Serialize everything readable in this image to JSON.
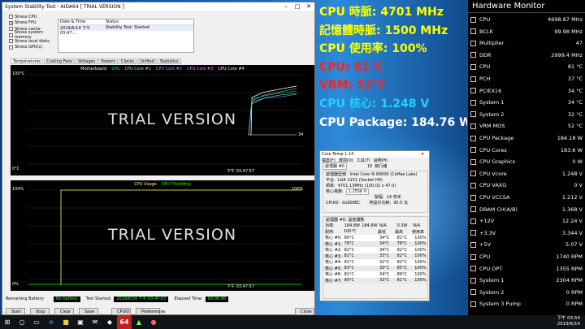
{
  "aida": {
    "title": "System Stability Test - AIDA64  [ TRIAL VERSION ]",
    "stress": [
      {
        "label": "Stress CPU",
        "checked": false
      },
      {
        "label": "Stress FPU",
        "checked": true
      },
      {
        "label": "Stress cache",
        "checked": false
      },
      {
        "label": "Stress system memory",
        "checked": false
      },
      {
        "label": "Stress local disks",
        "checked": false
      },
      {
        "label": "Stress GPU(s)",
        "checked": false
      }
    ],
    "status_headers": [
      "Date & Time",
      "Status"
    ],
    "status_row": [
      "2019/6/14 下午 03:47:...",
      "Stability Test: Started"
    ],
    "tabs": [
      "Temperatures",
      "Cooling Fans",
      "Voltages",
      "Powers",
      "Clocks",
      "Unified",
      "Statistics"
    ],
    "legend1": [
      "Motherboard",
      "CPU",
      "CPU Core #1",
      "CPU Core #2",
      "CPU Core #3",
      "CPU Core #4"
    ],
    "y_top1": "100°C",
    "y_bot1": "0°C",
    "time1": "下午 03:47:57",
    "val1": "34",
    "legend2": [
      "CPU Usage",
      "CPU Throttling"
    ],
    "y_top2": "100%",
    "y_bot2": "0%",
    "val2": "100%",
    "time2": "下午 03:47:57",
    "trial": "TRIAL VERSION",
    "battery_label": "Remaining Battery:",
    "battery_value": "No battery",
    "started_label": "Test Started:",
    "started_value": "2019/6/14 下午 03:47:57",
    "elapsed_label": "Elapsed Time:",
    "elapsed_value": "00:06:06",
    "buttons": [
      "Start",
      "Stop",
      "Clear",
      "Save",
      "CPUID",
      "Preferences",
      "Close"
    ]
  },
  "osd": [
    {
      "text": "CPU 時脈: 4701 MHz",
      "color": "#ffff00"
    },
    {
      "text": "記憶體時脈: 1500 MHz",
      "color": "#ffff00"
    },
    {
      "text": "CPU 使用率: 100%",
      "color": "#ffff00"
    },
    {
      "text": "CPU: 81°C",
      "color": "#ff2020"
    },
    {
      "text": "VRM: 52°C",
      "color": "#ff2020"
    },
    {
      "text": "CPU 核心: 1.248 V",
      "color": "#22d0ff"
    },
    {
      "text": "CPU Package: 184.76 W",
      "color": "#ffffff"
    }
  ],
  "coretemp": {
    "title": "Core Temp 1.14",
    "menu": [
      "檔案(F)",
      "選項(O)",
      "工具(T)",
      "說明(H)"
    ],
    "cpu_row": "處理器 #0",
    "threads": "16",
    "threads_label": "執行緒",
    "model_label": "處理器型號:",
    "model": "Intel Core i9 9900K (Coffee Lake)",
    "platform_label": "平台:",
    "platform": "LGA 1151 (Socket H4)",
    "freq_label": "頻率:",
    "freq": "4701.13MHz (100.02 x 47.0)",
    "vid_label": "核心電壓:",
    "vid": "1.2556 V",
    "lith_label": "製程:",
    "lith": "14 奈米",
    "cpuid_label": "CPUID:",
    "cpuid": "0x906EC",
    "tdp_label": "熱設計功耗:",
    "tdp": "95.0 瓦",
    "readings_title": "處理器 #0: 溫度讀數",
    "power_row": [
      "功率:",
      "184.8W",
      "184.8W",
      "N/A",
      "0.3W",
      "N/A"
    ],
    "tj_row": [
      "耐熱:",
      "100°C",
      "最低",
      "最高",
      "使用率"
    ],
    "cores": [
      {
        "n": "核心 #0:",
        "t": "80°C",
        "min": "34°C",
        "max": "81°C",
        "u": "100%"
      },
      {
        "n": "核心 #1:",
        "t": "76°C",
        "min": "34°C",
        "max": "78°C",
        "u": "100%"
      },
      {
        "n": "核心 #2:",
        "t": "82°C",
        "min": "34°C",
        "max": "82°C",
        "u": "100%"
      },
      {
        "n": "核心 #3:",
        "t": "82°C",
        "min": "33°C",
        "max": "82°C",
        "u": "100%"
      },
      {
        "n": "核心 #4:",
        "t": "81°C",
        "min": "32°C",
        "max": "82°C",
        "u": "100%"
      },
      {
        "n": "核心 #5:",
        "t": "83°C",
        "min": "33°C",
        "max": "85°C",
        "u": "100%"
      },
      {
        "n": "核心 #6:",
        "t": "81°C",
        "min": "34°C",
        "max": "89°C",
        "u": "100%"
      },
      {
        "n": "核心 #7:",
        "t": "80°C",
        "min": "33°C",
        "max": "81°C",
        "u": "100%"
      }
    ]
  },
  "hw": {
    "title": "Hardware Monitor",
    "rows": [
      {
        "l": "CPU",
        "v": "4698.87 MHz"
      },
      {
        "l": "BCLK",
        "v": "99.98 MHz"
      },
      {
        "l": "Multiplier",
        "v": "47"
      },
      {
        "l": "DDR",
        "v": "2999.4 MHz"
      },
      {
        "l": "CPU",
        "v": "81 °C"
      },
      {
        "l": "PCH",
        "v": "37 °C"
      },
      {
        "l": "PCIEX16",
        "v": "34 °C"
      },
      {
        "l": "System 1",
        "v": "34 °C"
      },
      {
        "l": "System 2",
        "v": "32 °C"
      },
      {
        "l": "VRM MOS",
        "v": "52 °C"
      },
      {
        "l": "CPU Package",
        "v": "184.18 W"
      },
      {
        "l": "CPU Cores",
        "v": "183.6 W"
      },
      {
        "l": "CPU Graphics",
        "v": "0 W"
      },
      {
        "l": "CPU Vcore",
        "v": "1.248 V"
      },
      {
        "l": "CPU VAXG",
        "v": "0 V"
      },
      {
        "l": "CPU VCCSA",
        "v": "1.212 V"
      },
      {
        "l": "DRAM CH(A/B)",
        "v": "1.368 V"
      },
      {
        "l": "+12V",
        "v": "12.24 V"
      },
      {
        "l": "+3.3V",
        "v": "3.344 V"
      },
      {
        "l": "+5V",
        "v": "5.07 V"
      },
      {
        "l": "CPU",
        "v": "1740 RPM"
      },
      {
        "l": "CPU OPT",
        "v": "1355 RPM"
      },
      {
        "l": "System 1",
        "v": "2304 RPM"
      },
      {
        "l": "System 2",
        "v": "0 RPM"
      },
      {
        "l": "System 3 Pump",
        "v": "0 RPM"
      }
    ]
  },
  "taskbar": {
    "time": "下午 03:54",
    "date": "2019/6/14"
  }
}
